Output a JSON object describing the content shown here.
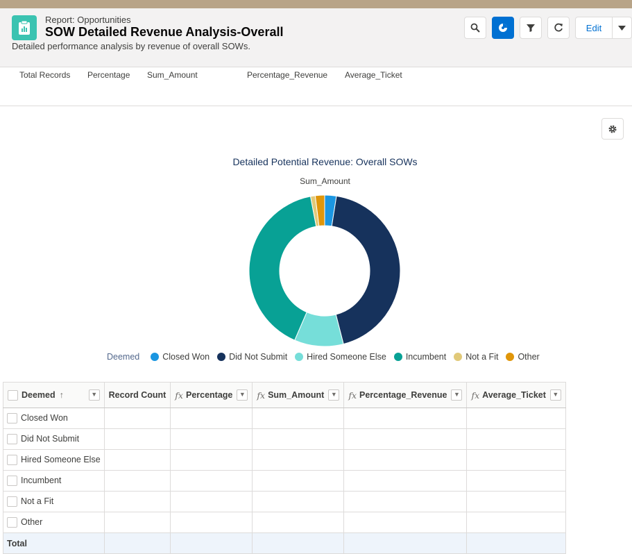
{
  "header": {
    "record_type": "Report: Opportunities",
    "title": "SOW Detailed Revenue Analysis-Overall",
    "description": "Detailed performance analysis by revenue of overall SOWs.",
    "edit_label": "Edit",
    "icons": [
      "report-icon",
      "search-icon",
      "chart-icon",
      "filter-icon",
      "refresh-icon",
      "chevron-down-icon"
    ]
  },
  "summary_labels": [
    "Total Records",
    "Percentage",
    "Sum_Amount",
    "Percentage_Revenue",
    "Average_Ticket"
  ],
  "chart_data": {
    "type": "pie",
    "title": "Detailed Potential Revenue: Overall SOWs",
    "subtitle": "Sum_Amount",
    "legend_title": "Deemed",
    "legend_position": "bottom",
    "categories": [
      "Closed Won",
      "Did Not Submit",
      "Hired Someone Else",
      "Incumbent",
      "Not a Fit",
      "Other"
    ],
    "values": [
      2.5,
      43.5,
      10.5,
      40.5,
      1.0,
      2.0
    ],
    "colors": [
      "#1b96e1",
      "#16325c",
      "#76ded9",
      "#08a195",
      "#e1c979",
      "#e0960a"
    ]
  },
  "table": {
    "columns": [
      {
        "label": "Deemed",
        "formula": false
      },
      {
        "label": "Record Count",
        "formula": false
      },
      {
        "label": "Percentage",
        "formula": true
      },
      {
        "label": "Sum_Amount",
        "formula": true
      },
      {
        "label": "Percentage_Revenue",
        "formula": true
      },
      {
        "label": "Average_Ticket",
        "formula": true
      }
    ],
    "rows": [
      "Closed Won",
      "Did Not Submit",
      "Hired Someone Else",
      "Incumbent",
      "Not a Fit",
      "Other"
    ],
    "total_label": "Total",
    "fx_symbol": "fx"
  }
}
